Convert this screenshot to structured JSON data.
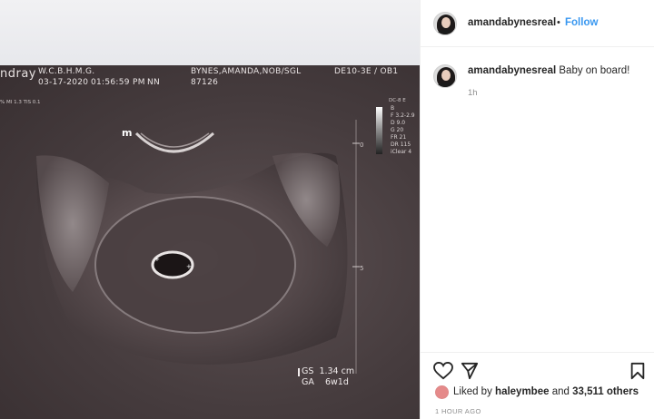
{
  "post": {
    "username": "amandabynesreal",
    "follow_label": "Follow",
    "separator": "•",
    "caption_text": "Baby on board!",
    "caption_time": "1h",
    "liked_prefix": "Liked by",
    "liked_user": "haleymbee",
    "liked_connector": "and",
    "liked_count": "33,511 others",
    "posted_ago": "1 HOUR AGO"
  },
  "ultrasound": {
    "brand": "ndray",
    "facility": "W.C.B.H.M.G.",
    "date": "03-17-2020",
    "time": "01:56:59 PM",
    "code_nn": "NN",
    "patient": "BYNES,AMANDA,NOB/SGL",
    "patient_id": "87126",
    "probe": "DE10-3E / OB1",
    "mi_tis": "% MI 1.3 TIS 0.1",
    "mode": "DC-8 E",
    "params": [
      "B",
      "F 3.2-2.9",
      "D 9.0",
      "G 20",
      "FR 21",
      "DR 115",
      "iClear 4"
    ],
    "depth_zero": "0",
    "depth_five": "5",
    "marker": "m",
    "measure_gs_label": "GS",
    "measure_gs_value": "1.34 cm",
    "measure_ga_label": "GA",
    "measure_ga_value": "6w1d"
  },
  "icons": {
    "heart": "heart-icon",
    "comment": "comment-icon",
    "bookmark": "bookmark-icon"
  },
  "colors": {
    "link_blue": "#3897f0",
    "text": "#262626",
    "muted": "#8e8e8e"
  }
}
